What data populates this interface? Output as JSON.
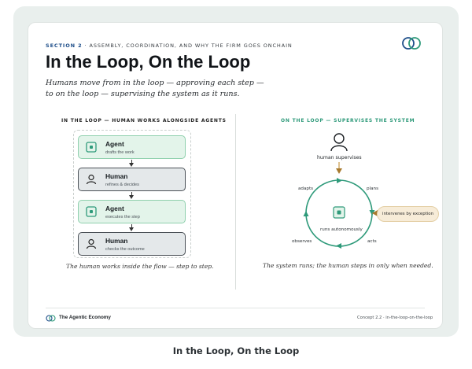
{
  "header": {
    "section_number": "SECTION 2",
    "section_text": " · ASSEMBLY, COORDINATION, AND WHY THE FIRM GOES ONCHAIN",
    "title": "In the Loop, On the Loop",
    "subtitle": "Humans move from in the loop — approving each step — to on the loop — supervising the system as it runs."
  },
  "left_panel": {
    "heading": "IN THE LOOP — HUMAN WORKS ALONGSIDE AGENTS",
    "steps": [
      {
        "kind": "agent",
        "label": "Agent",
        "sub": "drafts the work"
      },
      {
        "kind": "human",
        "label": "Human",
        "sub": "refines & decides"
      },
      {
        "kind": "agent",
        "label": "Agent",
        "sub": "executes the step"
      },
      {
        "kind": "human",
        "label": "Human",
        "sub": "checks the outcome"
      }
    ],
    "caption": "The human works inside the flow — step to step."
  },
  "right_panel": {
    "heading": "ON THE LOOP — SUPERVISES THE SYSTEM",
    "supervisor_label": "human supervises",
    "center_label": "runs autonomously",
    "loop_labels": {
      "top_left": "adapts",
      "top_right": "plans",
      "bottom_left": "observes",
      "bottom_right": "acts"
    },
    "exception_label": "intervenes by exception",
    "caption": "The system runs; the human steps in only when needed."
  },
  "footer": {
    "brand": "The Agentic Economy",
    "concept": "Concept 2.2 · in-the-loop-on-the-loop"
  },
  "bottom_title": "In the Loop, On the Loop",
  "colors": {
    "agent_fill": "#e3f4ea",
    "agent_border": "#8fd0ad",
    "human_fill": "#e4e8ea",
    "human_border": "#4a5056",
    "loop_green": "#2e9a7a",
    "accent_blue": "#1f4f8a",
    "exception_gold": "#c99a45"
  }
}
